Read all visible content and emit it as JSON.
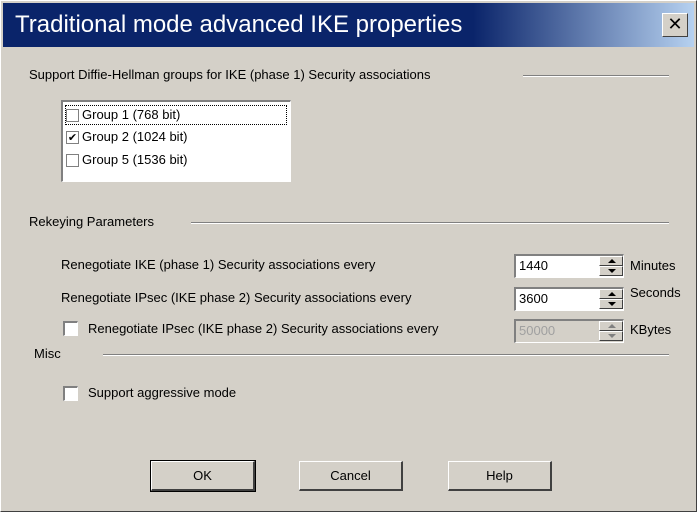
{
  "window": {
    "title": "Traditional mode advanced IKE properties",
    "close_glyph": "✕"
  },
  "dh_groups": {
    "legend": "Support Diffie-Hellman groups for IKE (phase 1) Security associations",
    "items": [
      {
        "label": "Group 1 (768 bit)",
        "checked": false
      },
      {
        "label": "Group 2 (1024 bit)",
        "checked": true
      },
      {
        "label": "Group 5 (1536 bit)",
        "checked": false
      }
    ]
  },
  "rekeying": {
    "legend": "Rekeying Parameters",
    "ike_label": "Renegotiate IKE (phase 1) Security associations every",
    "ike_value": "1440",
    "ike_unit": "Minutes",
    "ipsec_label": "Renegotiate IPsec (IKE phase 2) Security associations every",
    "ipsec_value": "3600",
    "ipsec_unit": "Seconds",
    "ipsec_kb_label": "Renegotiate IPsec (IKE phase 2) Security associations every",
    "ipsec_kb_checked": false,
    "ipsec_kb_value": "50000",
    "ipsec_kb_unit": "KBytes"
  },
  "misc": {
    "legend": "Misc",
    "aggressive_label": "Support aggressive mode",
    "aggressive_checked": false
  },
  "buttons": {
    "ok": "OK",
    "cancel": "Cancel",
    "help": "Help"
  },
  "icons": {
    "check": "checkmark-icon",
    "spin_up": "arrow-up-icon",
    "spin_down": "arrow-down-icon",
    "close": "close-icon"
  },
  "colors": {
    "title_start": "#0a246a",
    "title_end": "#b6d1f0",
    "face": "#d4d0c8"
  }
}
